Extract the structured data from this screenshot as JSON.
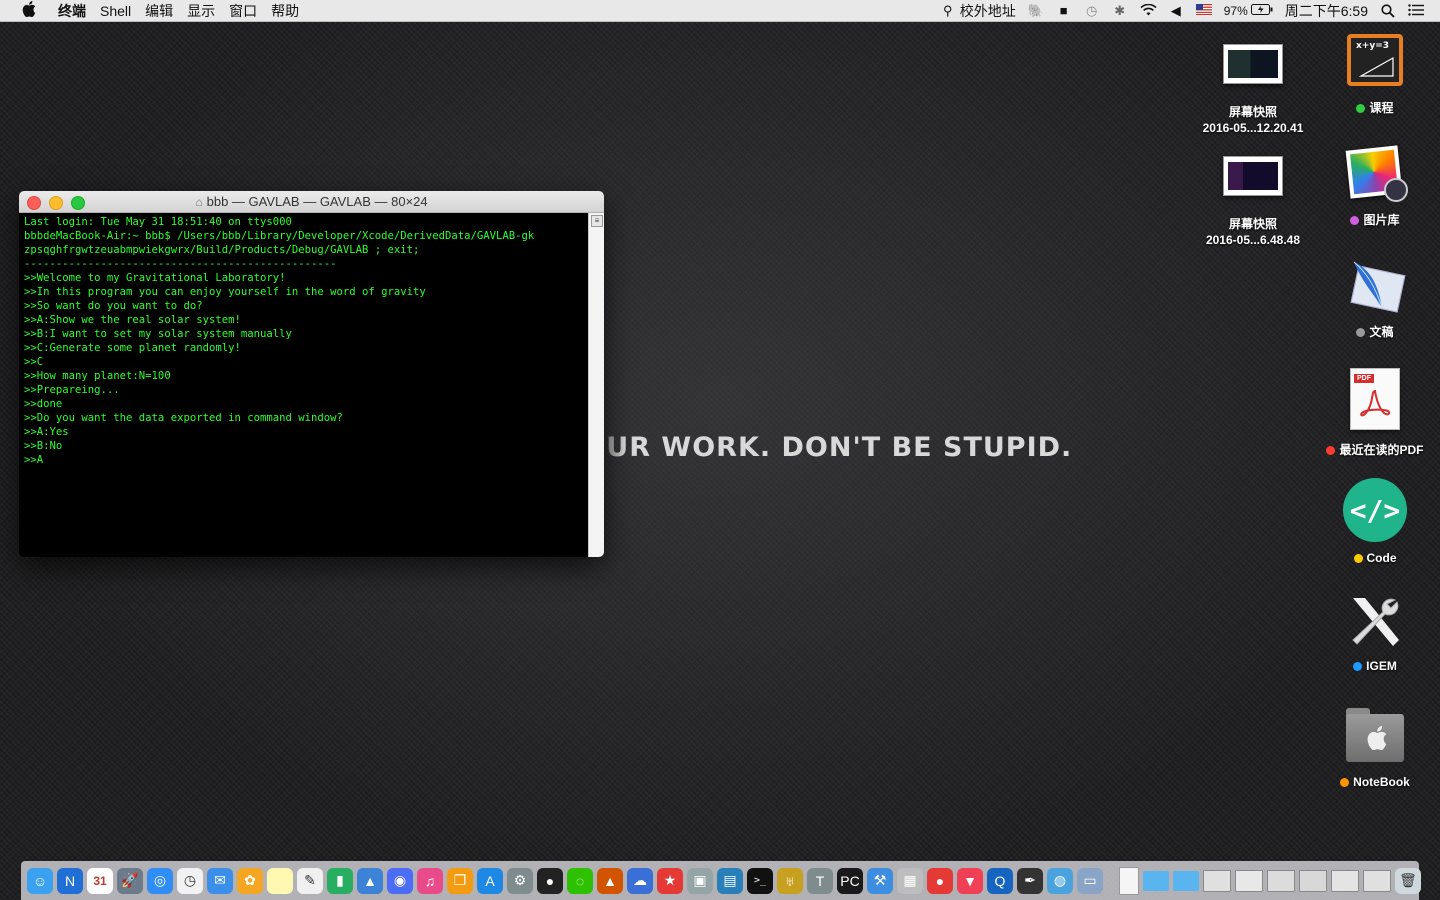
{
  "menubar": {
    "apple": "",
    "app_name": "终端",
    "menus": [
      "Shell",
      "编辑",
      "显示",
      "窗口",
      "帮助"
    ],
    "school_label": "校外地址",
    "battery": "97%",
    "clock": "周二下午6:59"
  },
  "wallpaper": {
    "slogan": "DO YOUR WORK. DON'T BE STUPID."
  },
  "terminal": {
    "title": "bbb — GAVLAB — GAVLAB — 80×24",
    "lines": [
      "Last login: Tue May 31 18:51:40 on ttys000",
      "bbbdeMacBook-Air:~ bbb$ /Users/bbb/Library/Developer/Xcode/DerivedData/GAVLAB-gk",
      "zpsqghfrgwtzeuabmpwiekgwrx/Build/Products/Debug/GAVLAB ; exit;",
      "-------------------------------------------------",
      ">>Welcome to my Gravitational Laboratory!",
      ">>In this program you can enjoy yourself in the word of gravity",
      ">>So want do you want to do?",
      ">>A:Show we the real solar system!",
      ">>B:I want to set my solar system manually",
      ">>C:Generate some planet randomly!",
      ">>C",
      ">>How many planet:N=100",
      ">>Prepareing...",
      ">>done",
      ">>Do you want the data exported in command window?",
      ">>A:Yes",
      ">>B:No",
      ">>A"
    ]
  },
  "desktop": {
    "screenshots": [
      {
        "name": "屏幕快照",
        "date": "2016-05...12.20.41"
      },
      {
        "name": "屏幕快照",
        "date": "2016-05...6.48.48"
      }
    ],
    "folders": [
      {
        "label": "课程",
        "tag_color": "#2ecc40"
      },
      {
        "label": "图片库",
        "tag_color": "#d25fe0"
      },
      {
        "label": "文稿",
        "tag_color": "#9a9a9a"
      },
      {
        "label": "最近在读的PDF",
        "tag_color": "#ff3b30"
      },
      {
        "label": "Code",
        "tag_color": "#ffcc00"
      },
      {
        "label": "IGEM",
        "tag_color": "#1e9bff"
      },
      {
        "label": "NoteBook",
        "tag_color": "#ff9500"
      }
    ],
    "icon_texts": {
      "course_board": "x+y=3",
      "pdf_badge": "PDF",
      "code_symbol": "</>"
    }
  },
  "dock": {
    "calendar_day": "31",
    "apps": [
      {
        "icon": "finder-icon",
        "color": "#3aa0f0"
      },
      {
        "icon": "n-app-icon",
        "color": "#1f6fd6"
      },
      {
        "icon": "calendar-icon",
        "color": "#ffffff"
      },
      {
        "icon": "launchpad-icon",
        "color": "#6c7a89"
      },
      {
        "icon": "safari-icon",
        "color": "#2f8df5"
      },
      {
        "icon": "clock-icon",
        "color": "#f2f2f2"
      },
      {
        "icon": "mail-icon",
        "color": "#3b8fe8"
      },
      {
        "icon": "photos-icon",
        "color": "#f5a623"
      },
      {
        "icon": "notes-icon",
        "color": "#fff8b0"
      },
      {
        "icon": "textedit-icon",
        "color": "#f0f0f0"
      },
      {
        "icon": "numbers-icon",
        "color": "#27ae60"
      },
      {
        "icon": "keynote-icon",
        "color": "#3c82d6"
      },
      {
        "icon": "siri-icon",
        "color": "#4a6cf7"
      },
      {
        "icon": "itunes-icon",
        "color": "#e94b8a"
      },
      {
        "icon": "ibooks-icon",
        "color": "#f39c12"
      },
      {
        "icon": "appstore-icon",
        "color": "#1e88e5"
      },
      {
        "icon": "system-preferences-icon",
        "color": "#7f8c8d"
      },
      {
        "icon": "qq-icon",
        "color": "#222222"
      },
      {
        "icon": "wechat-icon",
        "color": "#2dc100"
      },
      {
        "icon": "matlab-icon",
        "color": "#d35400"
      },
      {
        "icon": "cloud-icon",
        "color": "#3a6fd8"
      },
      {
        "icon": "bookmark-icon",
        "color": "#e53935"
      },
      {
        "icon": "preview-icon",
        "color": "#95a5a6"
      },
      {
        "icon": "screen-share-icon",
        "color": "#2980b9"
      },
      {
        "icon": "terminal-icon",
        "color": "#111111"
      },
      {
        "icon": "antenna-icon",
        "color": "#c7a020"
      },
      {
        "icon": "tex-icon",
        "color": "#7f8c8d"
      },
      {
        "icon": "pycharm-icon",
        "color": "#1a1a1a"
      },
      {
        "icon": "xcode-icon",
        "color": "#3d8ee0"
      },
      {
        "icon": "archive-icon",
        "color": "#bdbdbd"
      },
      {
        "icon": "drop-icon",
        "color": "#e53935"
      },
      {
        "icon": "pocket-icon",
        "color": "#ef4056"
      },
      {
        "icon": "q-app-icon",
        "color": "#1565c0"
      },
      {
        "icon": "pen-icon",
        "color": "#333333"
      },
      {
        "icon": "network-icon",
        "color": "#4aa3df"
      },
      {
        "icon": "folder-image-icon",
        "color": "#8aa4c8"
      }
    ],
    "stack_items": [
      {
        "icon": "document-icon",
        "color": "#f5f5f5"
      },
      {
        "icon": "folder-icon",
        "color": "#5ab4f0"
      },
      {
        "icon": "folder-icon",
        "color": "#5ab4f0"
      },
      {
        "icon": "window-thumb-icon",
        "color": "#e0e0e0"
      },
      {
        "icon": "window-thumb-icon",
        "color": "#e8e8e8"
      },
      {
        "icon": "window-thumb-icon",
        "color": "#dcdcdc"
      },
      {
        "icon": "window-thumb-icon",
        "color": "#d8d8d8"
      },
      {
        "icon": "window-thumb-icon",
        "color": "#e4e4e4"
      },
      {
        "icon": "window-thumb-icon",
        "color": "#e0e0e0"
      },
      {
        "icon": "trash-icon",
        "color": "#cfd8dc"
      }
    ]
  }
}
